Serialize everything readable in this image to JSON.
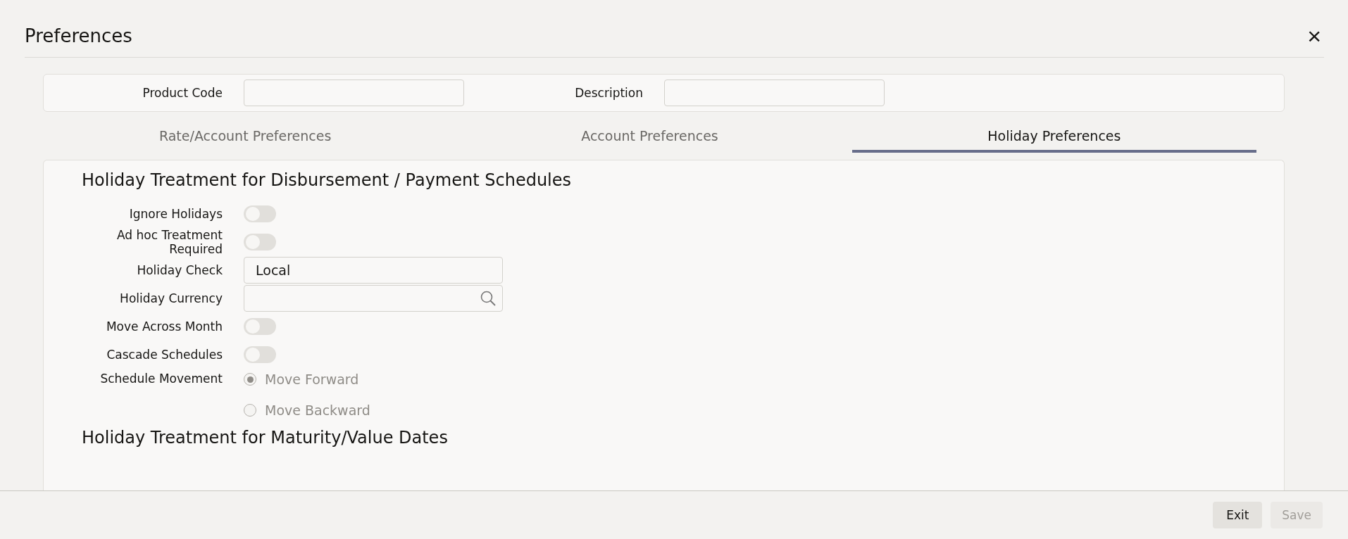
{
  "window": {
    "title": "Preferences",
    "close": "×"
  },
  "header_fields": [
    {
      "label": "Product Code"
    },
    {
      "label": "Description"
    }
  ],
  "tabs": [
    {
      "label": "Rate/Account Preferences",
      "selected": false
    },
    {
      "label": "Account Preferences",
      "selected": false
    },
    {
      "label": "Holiday Preferences",
      "selected": true
    }
  ],
  "sections": [
    {
      "heading": "Holiday Treatment for Disbursement / Payment Schedules",
      "rows": [
        {
          "kind": "toggle",
          "label": "Ignore Holidays",
          "checked": false
        },
        {
          "kind": "toggle",
          "label": "Ad hoc Treatment Required",
          "checked": false
        },
        {
          "kind": "text",
          "label": "Holiday Check",
          "value": "Local"
        },
        {
          "kind": "lookup",
          "label": "Holiday Currency"
        },
        {
          "kind": "toggle",
          "label": "Move Across Month",
          "checked": false
        },
        {
          "kind": "toggle",
          "label": "Cascade Schedules",
          "checked": false
        },
        {
          "kind": "radio",
          "label": "Schedule Movement",
          "disabled": true,
          "options": [
            {
              "label": "Move Forward",
              "selected": true
            },
            {
              "label": "Move Backward",
              "selected": false
            }
          ]
        }
      ]
    },
    {
      "heading": "Holiday Treatment for Maturity/Value Dates"
    }
  ],
  "buttons": [
    {
      "label": "Exit",
      "disabled": false
    },
    {
      "label": "Save",
      "disabled": true
    }
  ]
}
